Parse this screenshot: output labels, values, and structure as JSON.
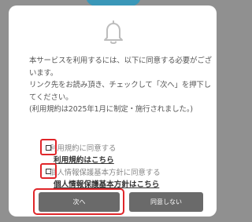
{
  "dialog": {
    "message": "本サービスを利用するには、以下に同意する必要がございます。\nリンク先をお読み頂き、チェックして「次へ」を押下してください。\n(利用規約は2025年1月に制定・施行されました。)",
    "terms": {
      "checkbox_label": "利用規約に同意する",
      "link_label": "利用規約はこちら",
      "checked": false
    },
    "privacy": {
      "checkbox_label": "個人情報保護基本方針に同意する",
      "link_label": "個人情報保護基本方針はこちら",
      "checked": false
    },
    "buttons": {
      "next": "次へ",
      "disagree": "同意しない"
    }
  },
  "colors": {
    "overlay": "#909090",
    "button": "#6a6a6a",
    "highlight": "#e0262a"
  },
  "icons": {
    "header": "bell-icon"
  }
}
